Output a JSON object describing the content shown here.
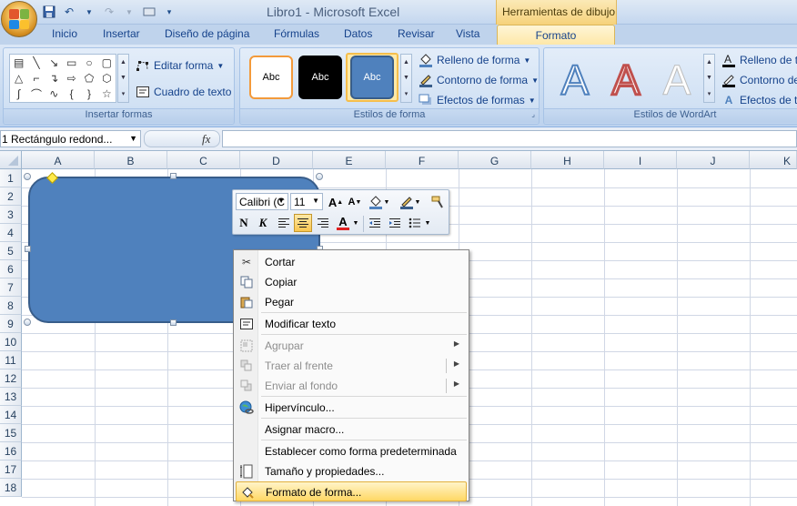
{
  "window": {
    "title": "Libro1 - Microsoft Excel",
    "context_title": "Herramientas de dibujo"
  },
  "tabs": [
    "Inicio",
    "Insertar",
    "Diseño de página",
    "Fórmulas",
    "Datos",
    "Revisar",
    "Vista"
  ],
  "active_tab": "Formato",
  "ribbon": {
    "insert_shapes": {
      "label": "Insertar formas",
      "edit_shape": "Editar forma",
      "text_box": "Cuadro de texto",
      "shapes": [
        "▭",
        "╲",
        "╲",
        "▭",
        "○",
        "▭",
        "△",
        "⌐",
        "↴",
        "⇨",
        "⬠",
        "⬡",
        "⌇",
        "⌒",
        "∿",
        "{",
        "}",
        "☆"
      ]
    },
    "shape_styles": {
      "label": "Estilos de forma",
      "sample_text": "Abc",
      "fill": "Relleno de forma",
      "outline": "Contorno de forma",
      "effects": "Efectos de formas"
    },
    "wordart_styles": {
      "label": "Estilos de WordArt",
      "fill": "Relleno de te",
      "outline": "Contorno de",
      "effects": "Efectos de te",
      "sample": "A"
    }
  },
  "formula_bar": {
    "name_box": "1 Rectángulo redond...",
    "fx": "fx",
    "value": ""
  },
  "columns": [
    "A",
    "B",
    "C",
    "D",
    "E",
    "F",
    "G",
    "H",
    "I",
    "J",
    "K"
  ],
  "rows": [
    "1",
    "2",
    "3",
    "4",
    "5",
    "6",
    "7",
    "8",
    "9",
    "10",
    "11",
    "12",
    "13",
    "14",
    "15",
    "16",
    "17",
    "18"
  ],
  "mini_toolbar": {
    "font": "Calibri (C",
    "size": "11",
    "bold": "N",
    "italic": "K"
  },
  "context_menu": {
    "cut": "Cortar",
    "copy": "Copiar",
    "paste": "Pegar",
    "edit_text": "Modificar texto",
    "group": "Agrupar",
    "bring_front": "Traer al frente",
    "send_back": "Enviar al fondo",
    "hyperlink": "Hipervínculo...",
    "assign_macro": "Asignar macro...",
    "set_default": "Establecer como forma predeterminada",
    "size_props": "Tamaño y propiedades...",
    "format_shape": "Formato de forma..."
  },
  "colors": {
    "shape_fill": "#4f81bd",
    "shape_border": "#385d8a",
    "ribbon": "#c6d9f0",
    "context_tab": "#f6d27b"
  }
}
